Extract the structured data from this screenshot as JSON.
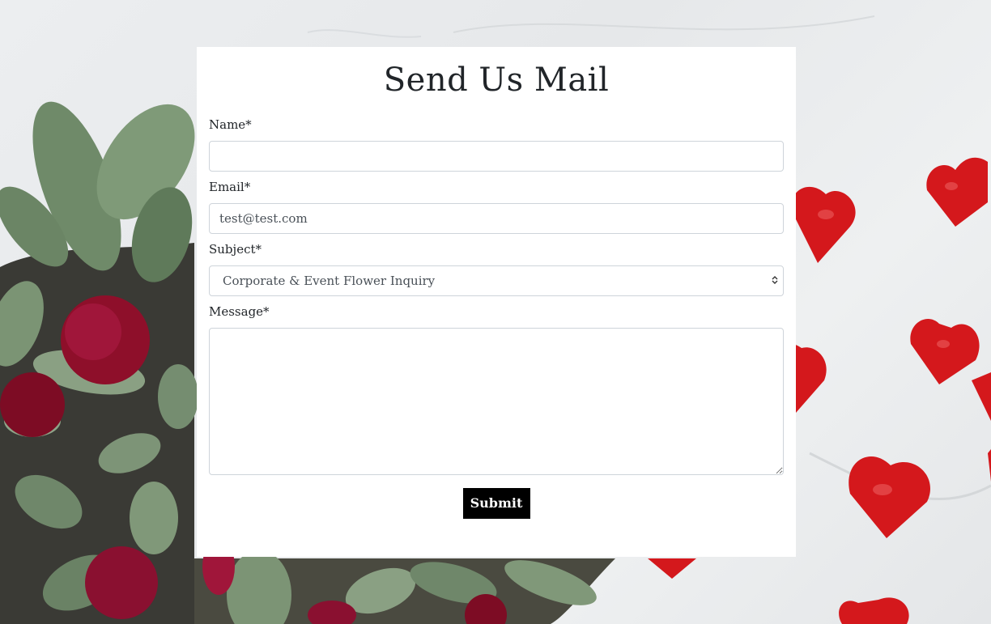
{
  "form": {
    "title": "Send Us Mail",
    "name_label": "Name*",
    "name_value": "",
    "email_label": "Email*",
    "email_value": "test@test.com",
    "subject_label": "Subject*",
    "subject_selected": "Corporate & Event Flower Inquiry",
    "message_label": "Message*",
    "message_value": "",
    "submit_label": "Submit"
  },
  "colors": {
    "button_bg": "#000000",
    "card_bg": "#ffffff",
    "heart_red": "#d4181c",
    "flower_crimson": "#8e0f2a",
    "leaf_green": "#6f8a69"
  },
  "background": {
    "left_icon": "bouquet-with-eucalyptus-and-carnations",
    "right_icon": "red-foil-heart-chocolates"
  }
}
